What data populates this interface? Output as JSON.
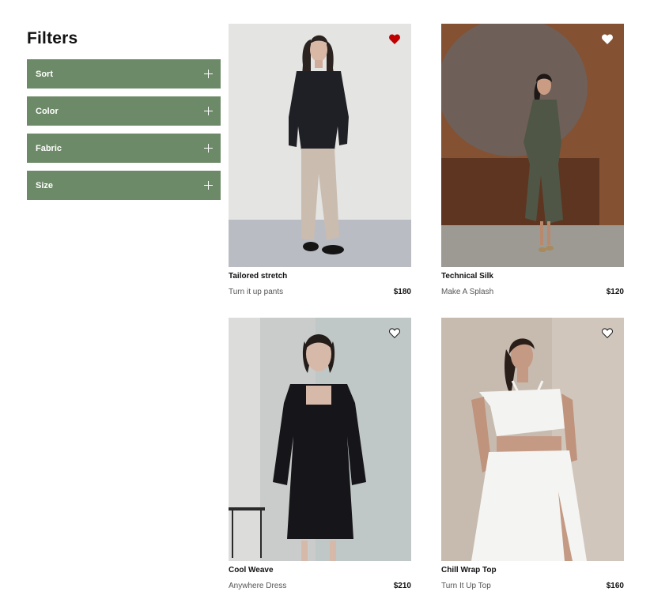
{
  "sidebar": {
    "title": "Filters",
    "filters": [
      {
        "label": "Sort"
      },
      {
        "label": "Color"
      },
      {
        "label": "Fabric"
      },
      {
        "label": "Size"
      }
    ]
  },
  "products": [
    {
      "title": "Tailored stretch",
      "subtitle": "Turn it up pants",
      "price": "$180",
      "favorited": true,
      "image_icon": "model-black-jacket-beige-pants"
    },
    {
      "title": "Technical Silk",
      "subtitle": "Make A Splash",
      "price": "$120",
      "favorited": false,
      "image_icon": "model-green-dress"
    },
    {
      "title": "Cool Weave",
      "subtitle": "Anywhere Dress",
      "price": "$210",
      "favorited": false,
      "image_icon": "model-black-dress"
    },
    {
      "title": "Chill Wrap Top",
      "subtitle": "Turn It Up Top",
      "price": "$160",
      "favorited": false,
      "image_icon": "model-white-top-skirt"
    }
  ],
  "colors": {
    "accent": "#6c8a67",
    "favorite": "#c00000"
  }
}
